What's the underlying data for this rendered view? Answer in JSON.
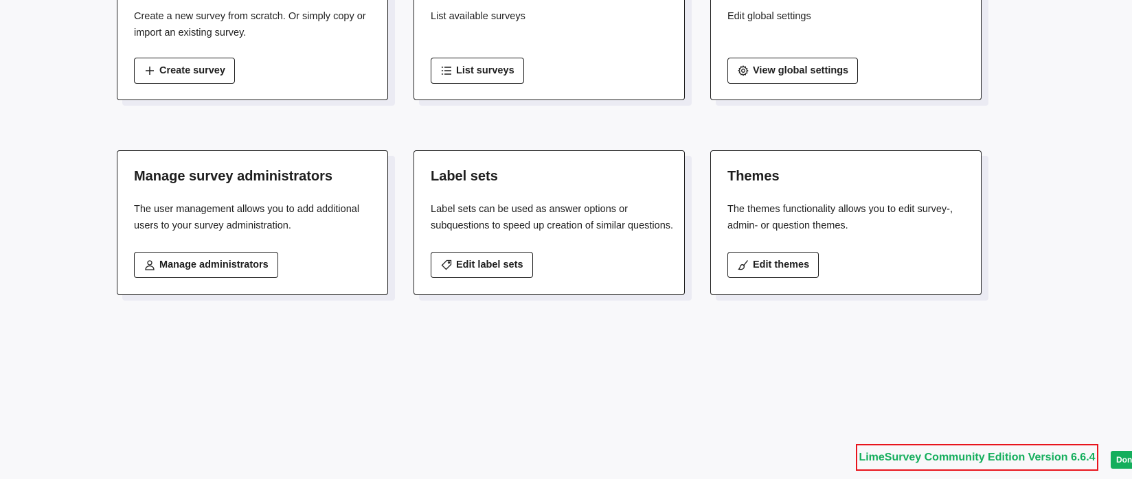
{
  "cards": [
    {
      "title": "",
      "description": "Create a new survey from scratch. Or simply copy or import an existing survey.",
      "button_label": "Create survey",
      "icon": "plus-icon"
    },
    {
      "title": "",
      "description": "List available surveys",
      "button_label": "List surveys",
      "icon": "list-icon"
    },
    {
      "title": "",
      "description": "Edit global settings",
      "button_label": "View global settings",
      "icon": "gear-icon"
    },
    {
      "title": "Manage survey administrators",
      "description": "The user management allows you to add additional users to your survey administration.",
      "button_label": "Manage administrators",
      "icon": "user-icon"
    },
    {
      "title": "Label sets",
      "description": "Label sets can be used as answer options or subquestions to speed up creation of similar questions.",
      "button_label": "Edit label sets",
      "icon": "tag-icon"
    },
    {
      "title": "Themes",
      "description": "The themes functionality allows you to edit survey-, admin- or question themes.",
      "button_label": "Edit themes",
      "icon": "brush-icon"
    }
  ],
  "footer": {
    "version_text": "LimeSurvey Community Edition Version 6.6.4",
    "donate_label": "Donate"
  },
  "colors": {
    "background": "#f8f8fa",
    "brand_green": "#14ae5c",
    "highlight_red": "#e8141c"
  }
}
